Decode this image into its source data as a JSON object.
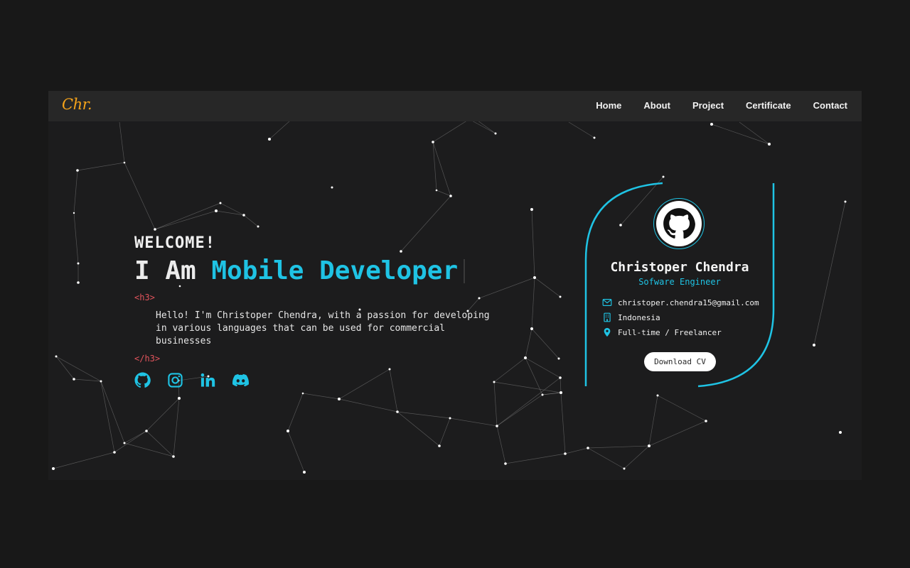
{
  "nav": {
    "logo": "Chr.",
    "links": [
      "Home",
      "About",
      "Project",
      "Certificate",
      "Contact"
    ]
  },
  "hero": {
    "welcome": "WELCOME!",
    "headline_prefix": "I Am ",
    "headline_role": "Mobile Developer",
    "tag_open": "<h3>",
    "description": "Hello! I'm Christoper Chendra, with a passion for developing in various languages that can be used for commercial businesses",
    "tag_close": "</h3>",
    "social_icons": [
      "github-icon",
      "instagram-icon",
      "linkedin-icon",
      "discord-icon"
    ]
  },
  "card": {
    "name": "Christoper Chendra",
    "role": "Sofware Engineer",
    "email": "christoper.chendra15@gmail.com",
    "location": "Indonesia",
    "employment": "Full-time / Freelancer",
    "cv_button": "Download CV",
    "avatar_icon": "github-octocat-icon"
  },
  "colors": {
    "accent": "#1fc3e4",
    "logo": "#f5a31a",
    "tag": "#e2545c",
    "background": "#1c1c1d",
    "navbar": "#272727"
  }
}
